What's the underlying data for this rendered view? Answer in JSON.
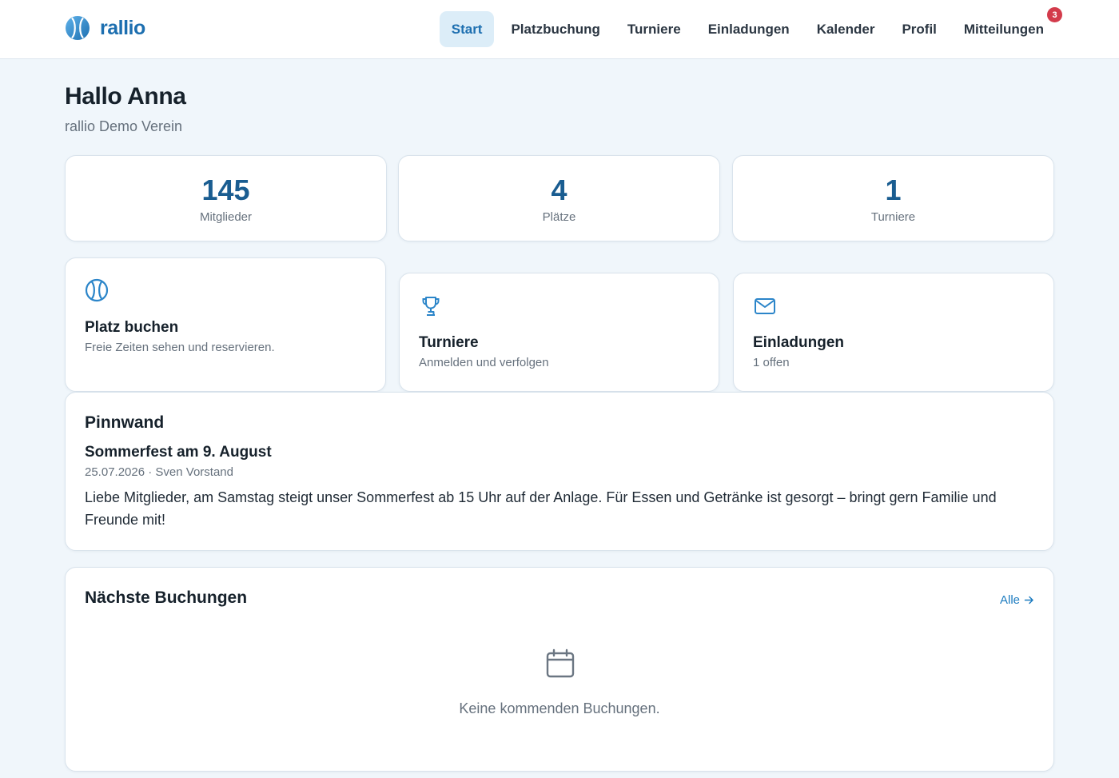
{
  "brand": {
    "name": "rallio",
    "accent": "#1d6fb0"
  },
  "nav": {
    "items": [
      {
        "label": "Start"
      },
      {
        "label": "Platzbuchung"
      },
      {
        "label": "Turniere"
      },
      {
        "label": "Einladungen"
      },
      {
        "label": "Kalender"
      },
      {
        "label": "Profil"
      },
      {
        "label": "Mitteilungen",
        "badge": "3"
      }
    ]
  },
  "greeting": "Hallo Anna",
  "club": "rallio Demo Verein",
  "stats": [
    {
      "value": "145",
      "label": "Mitglieder"
    },
    {
      "value": "4",
      "label": "Plätze"
    },
    {
      "value": "1",
      "label": "Turniere"
    }
  ],
  "actions": [
    {
      "icon": "tennis-ball-icon",
      "title": "Platz buchen",
      "subtitle": "Freie Zeiten sehen und reservieren."
    },
    {
      "icon": "trophy-icon",
      "title": "Turniere",
      "subtitle": "Anmelden und verfolgen"
    },
    {
      "icon": "mail-icon",
      "title": "Einladungen",
      "subtitle": "1 offen"
    }
  ],
  "pinboard": {
    "title": "Pinnwand",
    "post": {
      "title": "Sommerfest am 9. August",
      "meta": "25.07.2026 · Sven Vorstand",
      "body": "Liebe Mitglieder, am Samstag steigt unser Sommerfest ab 15 Uhr auf der Anlage. Für Essen und Getränke ist gesorgt – bringt gern Familie und Freunde mit!"
    }
  },
  "bookings": {
    "title": "Nächste Buchungen",
    "link": "Alle",
    "empty": "Keine kommenden Buchungen."
  },
  "colors": {
    "background": "#f0f6fb",
    "badge": "#d33b4b",
    "stat_number": "#1a5d91",
    "icon": "#2b85c9"
  }
}
